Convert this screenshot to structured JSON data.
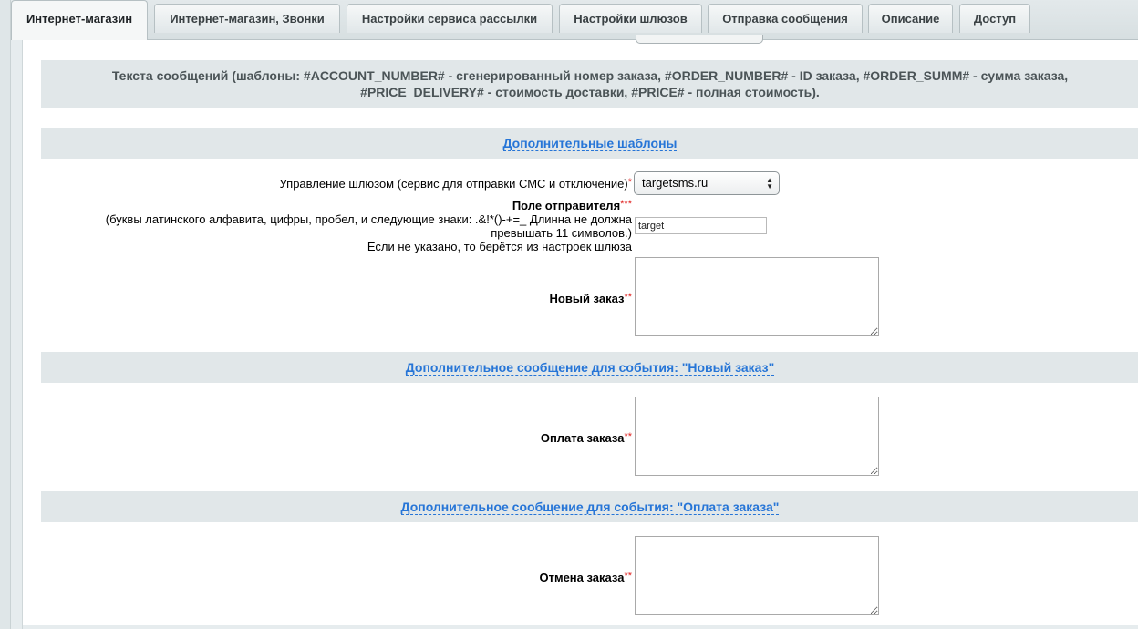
{
  "tabs": [
    {
      "label": "Интернет-магазин",
      "active": true
    },
    {
      "label": "Интернет-магазин, Звонки",
      "active": false
    },
    {
      "label": "Настройки сервиса рассылки",
      "active": false
    },
    {
      "label": "Настройки шлюзов",
      "active": false
    },
    {
      "label": "Отправка сообщения",
      "active": false
    },
    {
      "label": "Описание",
      "active": false
    },
    {
      "label": "Доступ",
      "active": false
    }
  ],
  "heading": {
    "line1": "Текста сообщений (шаблоны: #ACCOUNT_NUMBER# - сгенерированный номер заказа, #ORDER_NUMBER# - ID заказа, #ORDER_SUMM# - сумма заказа,",
    "line2": "#PRICE_DELIVERY# - стоимость доставки, #PRICE# - полная стоимость)."
  },
  "sections": {
    "extra_templates": "Дополнительные шаблоны",
    "new_order_extra": "Дополнительное сообщение для события: \"Новый заказ\"",
    "payment_extra": "Дополнительное сообщение для события: \"Оплата заказа\""
  },
  "gateway": {
    "label": "Управление шлюзом (сервис для отправки СМС и отключение)",
    "required_mark": "*",
    "value": "targetsms.ru"
  },
  "sender": {
    "label": "Поле отправителя",
    "required_mark": "***",
    "hint1": "(буквы латинского алфавита, цифры, пробел, и следующие знаки: .&!*()-+=_ Длинна не должна",
    "hint2": "превышать 11 символов.)",
    "hint3": "Если не указано, то берётся из настроек шлюза",
    "value": "target"
  },
  "fields": {
    "new_order": {
      "label": "Новый заказ",
      "required_mark": "**",
      "value": ""
    },
    "payment": {
      "label": "Оплата заказа",
      "required_mark": "**",
      "value": ""
    },
    "cancel": {
      "label": "Отмена заказа",
      "required_mark": "**",
      "value": ""
    }
  }
}
